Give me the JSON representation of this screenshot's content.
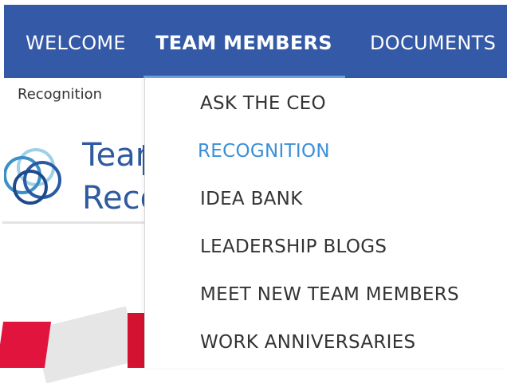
{
  "nav": {
    "items": [
      {
        "label": "WELCOME"
      },
      {
        "label": "TEAM MEMBERS"
      },
      {
        "label": "DOCUMENTS"
      }
    ]
  },
  "breadcrumb": "Recognition",
  "page": {
    "title_line1": "Tean",
    "title_line2": "Reco"
  },
  "dropdown": {
    "items": [
      {
        "label": "ASK THE CEO"
      },
      {
        "label": "RECOGNITION"
      },
      {
        "label": "IDEA  BANK"
      },
      {
        "label": "LEADERSHIP  BLOGS"
      },
      {
        "label": "MEET  NEW TEAM  MEMBERS"
      },
      {
        "label": "WORK ANNIVERSARIES"
      }
    ]
  },
  "colors": {
    "nav_bg": "#3459a6",
    "active_link": "#3a8fd8",
    "title": "#2f5aa0"
  }
}
